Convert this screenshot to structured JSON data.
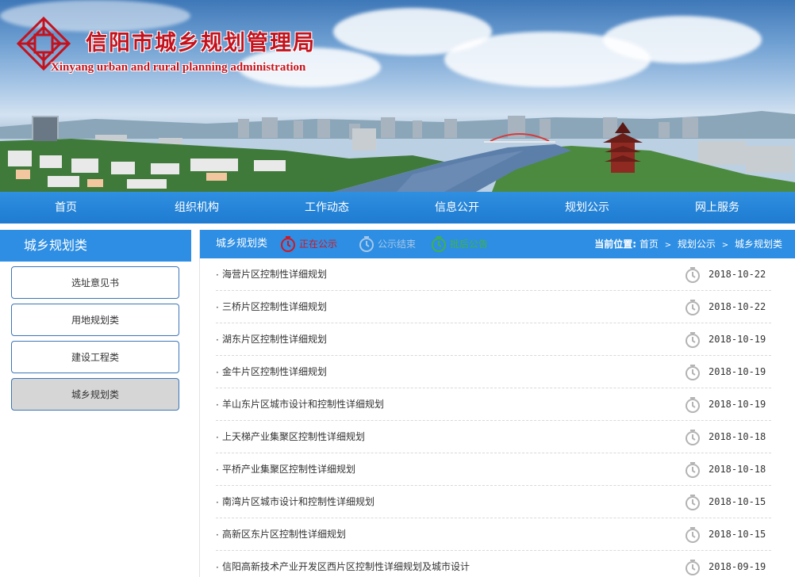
{
  "header": {
    "title": "信阳市城乡规划管理局",
    "subtitle": "Xinyang urban and rural planning administration",
    "brand_color": "#c4121d"
  },
  "nav": {
    "items": [
      {
        "label": "首页"
      },
      {
        "label": "组织机构"
      },
      {
        "label": "工作动态"
      },
      {
        "label": "信息公开"
      },
      {
        "label": "规划公示"
      },
      {
        "label": "网上服务"
      }
    ]
  },
  "sidebar": {
    "heading": "城乡规划类",
    "items": [
      {
        "label": "选址意见书"
      },
      {
        "label": "用地规划类"
      },
      {
        "label": "建设工程类"
      },
      {
        "label": "城乡规划类",
        "active": true
      }
    ]
  },
  "main": {
    "category": "城乡规划类",
    "statuses": {
      "open": {
        "label": "正在公示",
        "color": "#d7141e",
        "icon": "clock-icon"
      },
      "closed": {
        "label": "公示结束",
        "color": "#a8c8e8",
        "icon": "clock-icon"
      },
      "approved": {
        "label": "批后公告",
        "color": "#3fb24a",
        "icon": "clock-icon"
      }
    },
    "breadcrumb": {
      "prefix": "当前位置:",
      "items": [
        "首页",
        "规划公示",
        "城乡规划类"
      ],
      "separator": ">"
    },
    "rows": [
      {
        "title": "海营片区控制性详细规划",
        "date": "2018-10-22"
      },
      {
        "title": "三桥片区控制性详细规划",
        "date": "2018-10-22"
      },
      {
        "title": "湖东片区控制性详细规划",
        "date": "2018-10-19"
      },
      {
        "title": "金牛片区控制性详细规划",
        "date": "2018-10-19"
      },
      {
        "title": "羊山东片区城市设计和控制性详细规划",
        "date": "2018-10-19"
      },
      {
        "title": "上天梯产业集聚区控制性详细规划",
        "date": "2018-10-18"
      },
      {
        "title": "平桥产业集聚区控制性详细规划",
        "date": "2018-10-18"
      },
      {
        "title": "南湾片区城市设计和控制性详细规划",
        "date": "2018-10-15"
      },
      {
        "title": "高新区东片区控制性详细规划",
        "date": "2018-10-15"
      },
      {
        "title": "信阳高新技术产业开发区西片区控制性详细规划及城市设计",
        "date": "2018-09-19"
      }
    ],
    "row_bullet": "·"
  },
  "colors": {
    "nav_bg": "#1e7bd1",
    "panel_head_bg": "#2d8ee3",
    "sidebar_border": "#3b76b8",
    "active_item_bg": "#d6d6d6"
  }
}
